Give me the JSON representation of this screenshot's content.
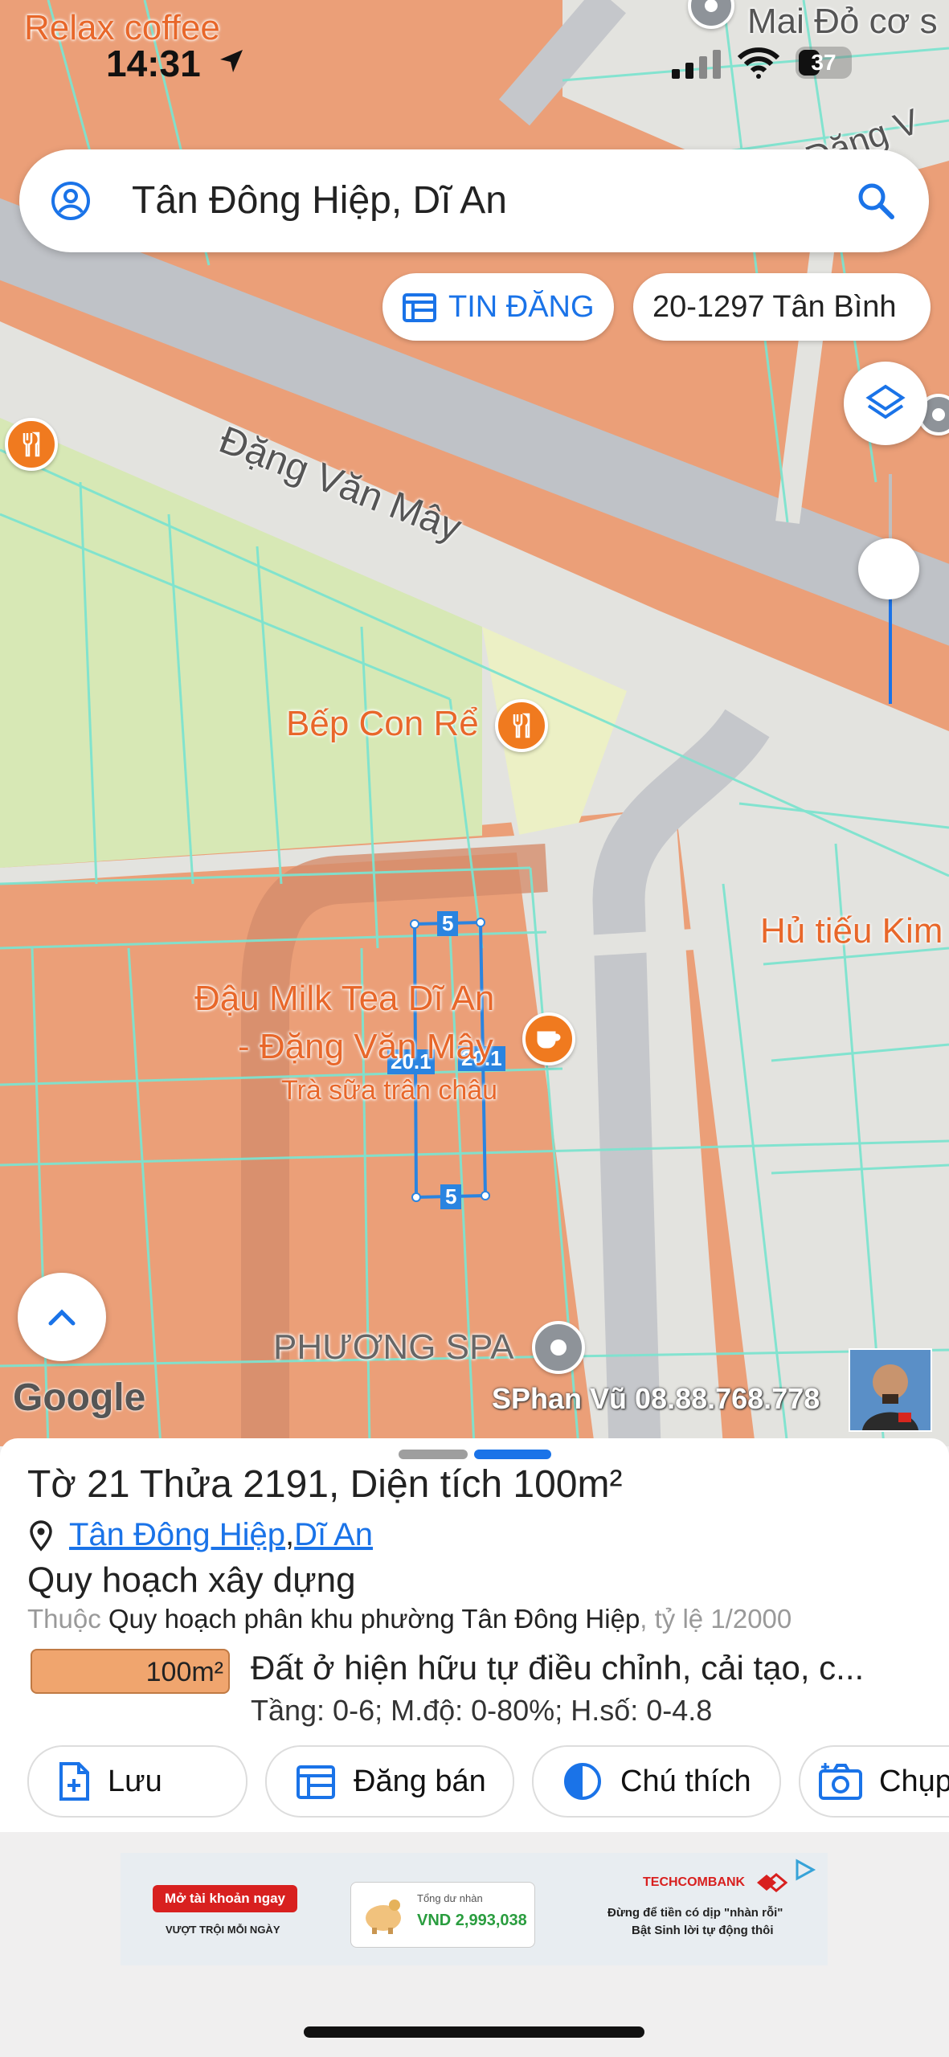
{
  "status_bar": {
    "time": "14:31",
    "battery": "37"
  },
  "search": {
    "query": "Tân Đông Hiệp, Dĩ An"
  },
  "chips": {
    "listing": "TIN ĐĂNG",
    "parcel_ref": "20-1297 Tân Bình"
  },
  "map": {
    "labels": {
      "relax_coffee": "Relax coffee",
      "mai_do": "Mai Đỏ cơ s",
      "dang_v_top": "Đặng V",
      "road": "Đặng Văn Mây",
      "bep_con_re": "Bếp Con Rể",
      "hu_tieu": "Hủ tiếu Kim",
      "dau_milk_tea_1": "Đậu Milk Tea Dĩ An",
      "dau_milk_tea_2": "- Đặng Văn Mây",
      "tra_sua": "Trà sữa trân châu",
      "phuong_spa": "PHƯƠNG SPA"
    },
    "dimensions": {
      "top": "5",
      "bottom": "5",
      "left": "20.1",
      "right": "20.1"
    },
    "google": "Google",
    "watermark": "SPhan Vũ 08.88.768.778"
  },
  "sheet": {
    "title_prefix": "Tờ ",
    "sheet_no": "21",
    "plot_prefix": " Thửa ",
    "plot_no": "2191",
    "area_prefix": ", Diện tích ",
    "area_value": "100m²",
    "location_ward": "Tân Đông Hiệp",
    "location_sep": ", ",
    "location_district": "Dĩ An",
    "section_title": "Quy hoạch xây dựng",
    "belongs_prefix": "Thuộc ",
    "plan_name": "Quy hoạch phân khu phường Tân Đông Hiệp",
    "scale_text": ", tỷ lệ 1/2000",
    "zone_area": "100m²",
    "zone_desc": "Đất ở hiện hữu tự điều chỉnh, cải tạo, c...",
    "zone_specs": "Tầng: 0-6; M.độ: 0-80%; H.số: 0-4.8",
    "zone_color": "#f0a56e"
  },
  "actions": {
    "save": "Lưu",
    "post": "Đăng bán",
    "legend": "Chú thích",
    "capture": "Chụp"
  },
  "ad": {
    "open_account": "Mở tài khoản ngay",
    "tagline": "VƯỢT TRỘI MỖI NGÀY",
    "balance_label": "Tổng dư nhàn",
    "balance_value": "VND 2,993,038",
    "brand": "TECHCOMBANK",
    "line1": "Đừng để tiền có dịp \"nhàn rỗi\"",
    "line2": "Bật Sinh lời tự động thôi"
  },
  "colors": {
    "accent": "#1a73e8",
    "map_orange": "#eb9f78",
    "parcel_line": "#7de3cf",
    "poi_orange": "#f07a1f"
  }
}
